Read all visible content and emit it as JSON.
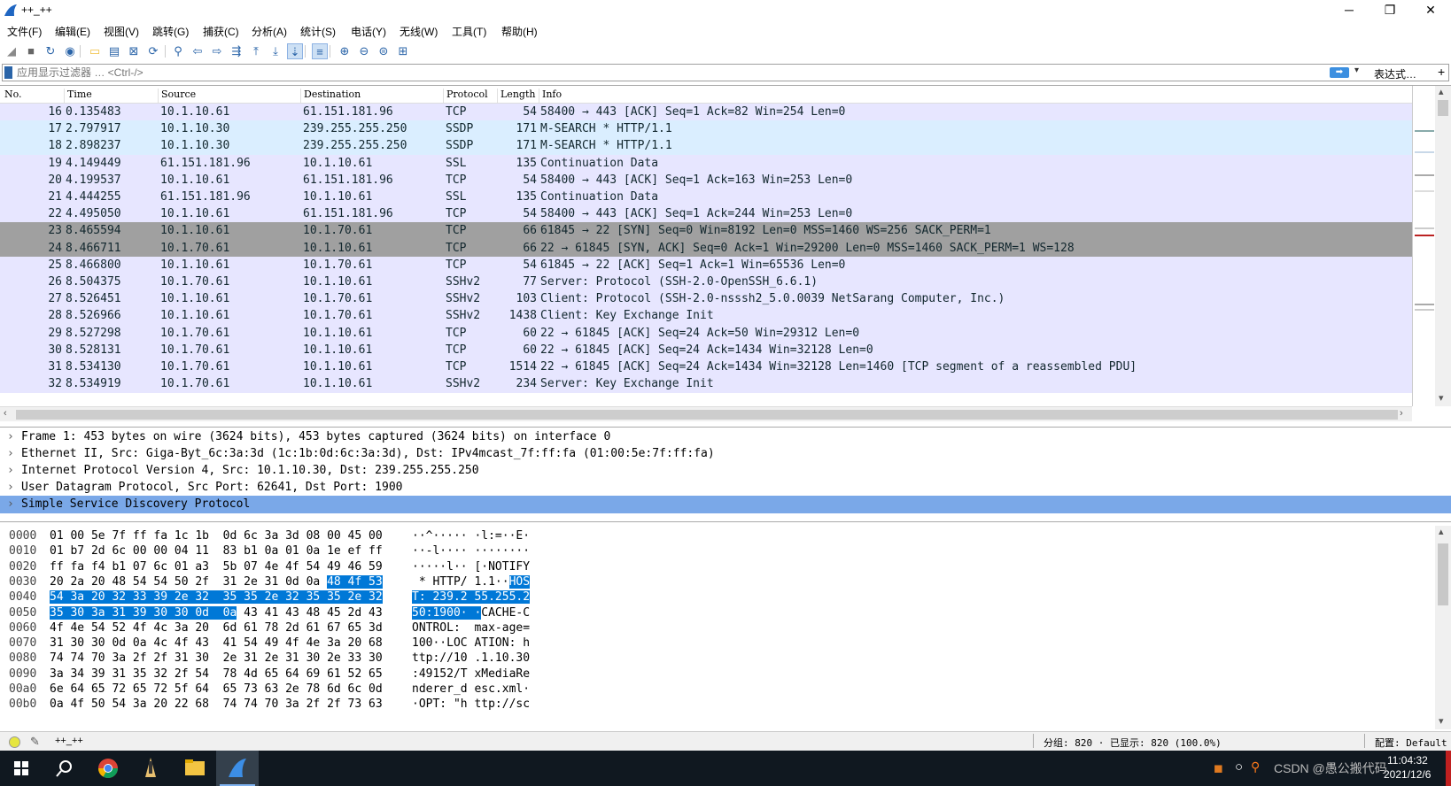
{
  "window": {
    "title": "++_++",
    "minimize": "─",
    "maximize": "❐",
    "close": "✕"
  },
  "menu": [
    "文件(F)",
    "编辑(E)",
    "视图(V)",
    "跳转(G)",
    "捕获(C)",
    "分析(A)",
    "统计(S)",
    "电话(Y)",
    "无线(W)",
    "工具(T)",
    "帮助(H)"
  ],
  "toolbar": {
    "icons": [
      "shark-fin-start-icon",
      "stop-icon",
      "restart-icon",
      "options-icon",
      "open-file-icon",
      "save-icon",
      "close-file-icon",
      "reload-icon",
      "find-icon",
      "back-icon",
      "forward-icon",
      "goto-packet-icon",
      "first-packet-icon",
      "last-packet-icon",
      "autoscroll-icon",
      "colorize-icon",
      "zoom-in-icon",
      "zoom-out-icon",
      "normal-size-icon",
      "resize-columns-icon"
    ]
  },
  "filter": {
    "placeholder": "应用显示过滤器 … <Ctrl-/>",
    "expression_label": "表达式…",
    "add": "+"
  },
  "packet_list": {
    "columns": [
      "No.",
      "Time",
      "Source",
      "Destination",
      "Protocol",
      "Length",
      "Info"
    ],
    "rows": [
      {
        "no": "16",
        "time": "0.135483",
        "src": "10.1.10.61",
        "dst": "61.151.181.96",
        "proto": "TCP",
        "len": "54",
        "info": "58400 → 443 [ACK] Seq=1 Ack=82 Win=254 Len=0",
        "bg": "#e7e6ff",
        "fg": "#12272e"
      },
      {
        "no": "17",
        "time": "2.797917",
        "src": "10.1.10.30",
        "dst": "239.255.255.250",
        "proto": "SSDP",
        "len": "171",
        "info": "M-SEARCH * HTTP/1.1",
        "bg": "#daeeff",
        "fg": "#12272e"
      },
      {
        "no": "18",
        "time": "2.898237",
        "src": "10.1.10.30",
        "dst": "239.255.255.250",
        "proto": "SSDP",
        "len": "171",
        "info": "M-SEARCH * HTTP/1.1",
        "bg": "#daeeff",
        "fg": "#12272e"
      },
      {
        "no": "19",
        "time": "4.149449",
        "src": "61.151.181.96",
        "dst": "10.1.10.61",
        "proto": "SSL",
        "len": "135",
        "info": "Continuation Data",
        "bg": "#e7e6ff",
        "fg": "#12272e"
      },
      {
        "no": "20",
        "time": "4.199537",
        "src": "10.1.10.61",
        "dst": "61.151.181.96",
        "proto": "TCP",
        "len": "54",
        "info": "58400 → 443 [ACK] Seq=1 Ack=163 Win=253 Len=0",
        "bg": "#e7e6ff",
        "fg": "#12272e"
      },
      {
        "no": "21",
        "time": "4.444255",
        "src": "61.151.181.96",
        "dst": "10.1.10.61",
        "proto": "SSL",
        "len": "135",
        "info": "Continuation Data",
        "bg": "#e7e6ff",
        "fg": "#12272e"
      },
      {
        "no": "22",
        "time": "4.495050",
        "src": "10.1.10.61",
        "dst": "61.151.181.96",
        "proto": "TCP",
        "len": "54",
        "info": "58400 → 443 [ACK] Seq=1 Ack=244 Win=253 Len=0",
        "bg": "#e7e6ff",
        "fg": "#12272e"
      },
      {
        "no": "23",
        "time": "8.465594",
        "src": "10.1.10.61",
        "dst": "10.1.70.61",
        "proto": "TCP",
        "len": "66",
        "info": "61845 → 22 [SYN] Seq=0 Win=8192 Len=0 MSS=1460 WS=256 SACK_PERM=1",
        "bg": "#a0a0a0",
        "fg": "#12272e"
      },
      {
        "no": "24",
        "time": "8.466711",
        "src": "10.1.70.61",
        "dst": "10.1.10.61",
        "proto": "TCP",
        "len": "66",
        "info": "22 → 61845 [SYN, ACK] Seq=0 Ack=1 Win=29200 Len=0 MSS=1460 SACK_PERM=1 WS=128",
        "bg": "#a0a0a0",
        "fg": "#12272e"
      },
      {
        "no": "25",
        "time": "8.466800",
        "src": "10.1.10.61",
        "dst": "10.1.70.61",
        "proto": "TCP",
        "len": "54",
        "info": "61845 → 22 [ACK] Seq=1 Ack=1 Win=65536 Len=0",
        "bg": "#e7e6ff",
        "fg": "#12272e"
      },
      {
        "no": "26",
        "time": "8.504375",
        "src": "10.1.70.61",
        "dst": "10.1.10.61",
        "proto": "SSHv2",
        "len": "77",
        "info": "Server: Protocol (SSH-2.0-OpenSSH_6.6.1)",
        "bg": "#e7e6ff",
        "fg": "#12272e"
      },
      {
        "no": "27",
        "time": "8.526451",
        "src": "10.1.10.61",
        "dst": "10.1.70.61",
        "proto": "SSHv2",
        "len": "103",
        "info": "Client: Protocol (SSH-2.0-nsssh2_5.0.0039 NetSarang Computer, Inc.)",
        "bg": "#e7e6ff",
        "fg": "#12272e"
      },
      {
        "no": "28",
        "time": "8.526966",
        "src": "10.1.10.61",
        "dst": "10.1.70.61",
        "proto": "SSHv2",
        "len": "1438",
        "info": "Client: Key Exchange Init",
        "bg": "#e7e6ff",
        "fg": "#12272e"
      },
      {
        "no": "29",
        "time": "8.527298",
        "src": "10.1.70.61",
        "dst": "10.1.10.61",
        "proto": "TCP",
        "len": "60",
        "info": "22 → 61845 [ACK] Seq=24 Ack=50 Win=29312 Len=0",
        "bg": "#e7e6ff",
        "fg": "#12272e"
      },
      {
        "no": "30",
        "time": "8.528131",
        "src": "10.1.70.61",
        "dst": "10.1.10.61",
        "proto": "TCP",
        "len": "60",
        "info": "22 → 61845 [ACK] Seq=24 Ack=1434 Win=32128 Len=0",
        "bg": "#e7e6ff",
        "fg": "#12272e"
      },
      {
        "no": "31",
        "time": "8.534130",
        "src": "10.1.70.61",
        "dst": "10.1.10.61",
        "proto": "TCP",
        "len": "1514",
        "info": "22 → 61845 [ACK] Seq=24 Ack=1434 Win=32128 Len=1460 [TCP segment of a reassembled PDU]",
        "bg": "#e7e6ff",
        "fg": "#12272e"
      },
      {
        "no": "32",
        "time": "8.534919",
        "src": "10.1.70.61",
        "dst": "10.1.10.61",
        "proto": "SSHv2",
        "len": "234",
        "info": "Server: Key Exchange Init",
        "bg": "#e7e6ff",
        "fg": "#12272e"
      }
    ]
  },
  "details": [
    {
      "text": "Frame 1: 453 bytes on wire (3624 bits), 453 bytes captured (3624 bits) on interface 0",
      "selected": false
    },
    {
      "text": "Ethernet II, Src: Giga-Byt_6c:3a:3d (1c:1b:0d:6c:3a:3d), Dst: IPv4mcast_7f:ff:fa (01:00:5e:7f:ff:fa)",
      "selected": false
    },
    {
      "text": "Internet Protocol Version 4, Src: 10.1.10.30, Dst: 239.255.255.250",
      "selected": false
    },
    {
      "text": "User Datagram Protocol, Src Port: 62641, Dst Port: 1900",
      "selected": false
    },
    {
      "text": "Simple Service Discovery Protocol",
      "selected": true
    }
  ],
  "bytes": [
    {
      "off": "0000",
      "hex": [
        [
          "01 00 5e 7f ff fa 1c 1b  0d 6c 3a 3d 08 00 45 00",
          false
        ]
      ],
      "asc": [
        [
          "··^····· ·l:=··E·",
          false
        ]
      ]
    },
    {
      "off": "0010",
      "hex": [
        [
          "01 b7 2d 6c 00 00 04 11  83 b1 0a 01 0a 1e ef ff",
          false
        ]
      ],
      "asc": [
        [
          "··-l···· ········",
          false
        ]
      ]
    },
    {
      "off": "0020",
      "hex": [
        [
          "ff fa f4 b1 07 6c 01 a3  5b 07 4e 4f 54 49 46 59",
          false
        ]
      ],
      "asc": [
        [
          "·····l·· [·NOTIFY",
          false
        ]
      ]
    },
    {
      "off": "0030",
      "hex": [
        [
          "20 2a 20 48 54 54 50 2f  31 2e 31 0d 0a ",
          false
        ],
        [
          "48 4f 53",
          true
        ]
      ],
      "asc": [
        [
          " * HTTP/ 1.1··",
          false
        ],
        [
          "HOS",
          true
        ]
      ]
    },
    {
      "off": "0040",
      "hex": [
        [
          "54 3a 20 32 33 39 2e 32  35 35 2e 32 35 35 2e 32",
          true
        ]
      ],
      "asc": [
        [
          "T: 239.2 55.255.2",
          true
        ]
      ]
    },
    {
      "off": "0050",
      "hex": [
        [
          "35 30 3a 31 39 30 30 0d  0a",
          true
        ],
        [
          " 43 41 43 48 45 2d 43",
          false
        ]
      ],
      "asc": [
        [
          "50:1900· ·",
          true
        ],
        [
          "CACHE-C",
          false
        ]
      ]
    },
    {
      "off": "0060",
      "hex": [
        [
          "4f 4e 54 52 4f 4c 3a 20  6d 61 78 2d 61 67 65 3d",
          false
        ]
      ],
      "asc": [
        [
          "ONTROL:  max-age=",
          false
        ]
      ]
    },
    {
      "off": "0070",
      "hex": [
        [
          "31 30 30 0d 0a 4c 4f 43  41 54 49 4f 4e 3a 20 68",
          false
        ]
      ],
      "asc": [
        [
          "100··LOC ATION: h",
          false
        ]
      ]
    },
    {
      "off": "0080",
      "hex": [
        [
          "74 74 70 3a 2f 2f 31 30  2e 31 2e 31 30 2e 33 30",
          false
        ]
      ],
      "asc": [
        [
          "ttp://10 .1.10.30",
          false
        ]
      ]
    },
    {
      "off": "0090",
      "hex": [
        [
          "3a 34 39 31 35 32 2f 54  78 4d 65 64 69 61 52 65",
          false
        ]
      ],
      "asc": [
        [
          ":49152/T xMediaRe",
          false
        ]
      ]
    },
    {
      "off": "00a0",
      "hex": [
        [
          "6e 64 65 72 65 72 5f 64  65 73 63 2e 78 6d 6c 0d",
          false
        ]
      ],
      "asc": [
        [
          "nderer_d esc.xml·",
          false
        ]
      ]
    },
    {
      "off": "00b0",
      "hex": [
        [
          "0a 4f 50 54 3a 20 22 68  74 74 70 3a 2f 2f 73 63",
          false
        ]
      ],
      "asc": [
        [
          "·OPT: \"h ttp://sc",
          false
        ]
      ]
    }
  ],
  "status": {
    "profile_name": "++_++",
    "packets": "分组: 820 · 已显示: 820 (100.0%)",
    "config": "配置: Default"
  },
  "taskbar": {
    "time": "11:04:32",
    "date": "2021/12/6",
    "watermark": "CSDN @愚公搬代码"
  }
}
